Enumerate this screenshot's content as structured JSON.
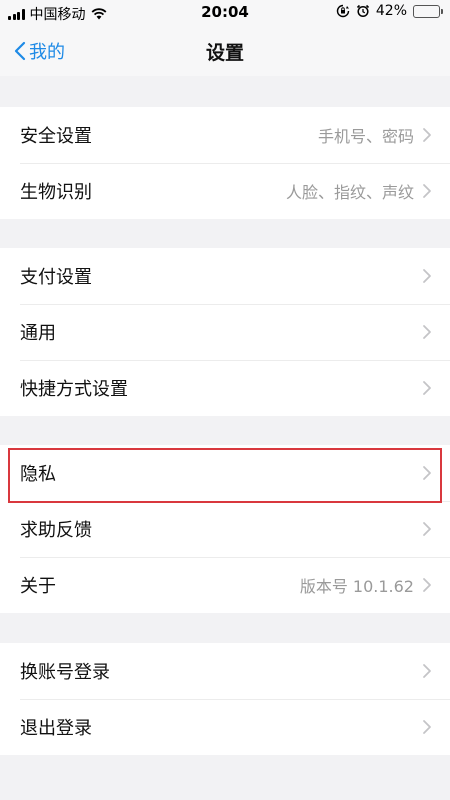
{
  "status_bar": {
    "carrier": "中国移动",
    "time": "20:04",
    "battery_percent_label": "42%",
    "battery_level": 0.42,
    "colors": {
      "battery": "#f5c518"
    }
  },
  "nav": {
    "back_label": "我的",
    "title": "设置",
    "accent_color": "#1e8ae6"
  },
  "groups": [
    {
      "items": [
        {
          "label": "安全设置",
          "value": "手机号、密码"
        },
        {
          "label": "生物识别",
          "value": "人脸、指纹、声纹"
        }
      ]
    },
    {
      "items": [
        {
          "label": "支付设置",
          "value": ""
        },
        {
          "label": "通用",
          "value": ""
        },
        {
          "label": "快捷方式设置",
          "value": ""
        }
      ]
    },
    {
      "items": [
        {
          "label": "隐私",
          "value": "",
          "highlighted": true
        },
        {
          "label": "求助反馈",
          "value": ""
        },
        {
          "label": "关于",
          "value": "版本号 10.1.62"
        }
      ]
    },
    {
      "items": [
        {
          "label": "换账号登录",
          "value": ""
        },
        {
          "label": "退出登录",
          "value": ""
        }
      ]
    }
  ],
  "highlight_color": "#d9383e"
}
